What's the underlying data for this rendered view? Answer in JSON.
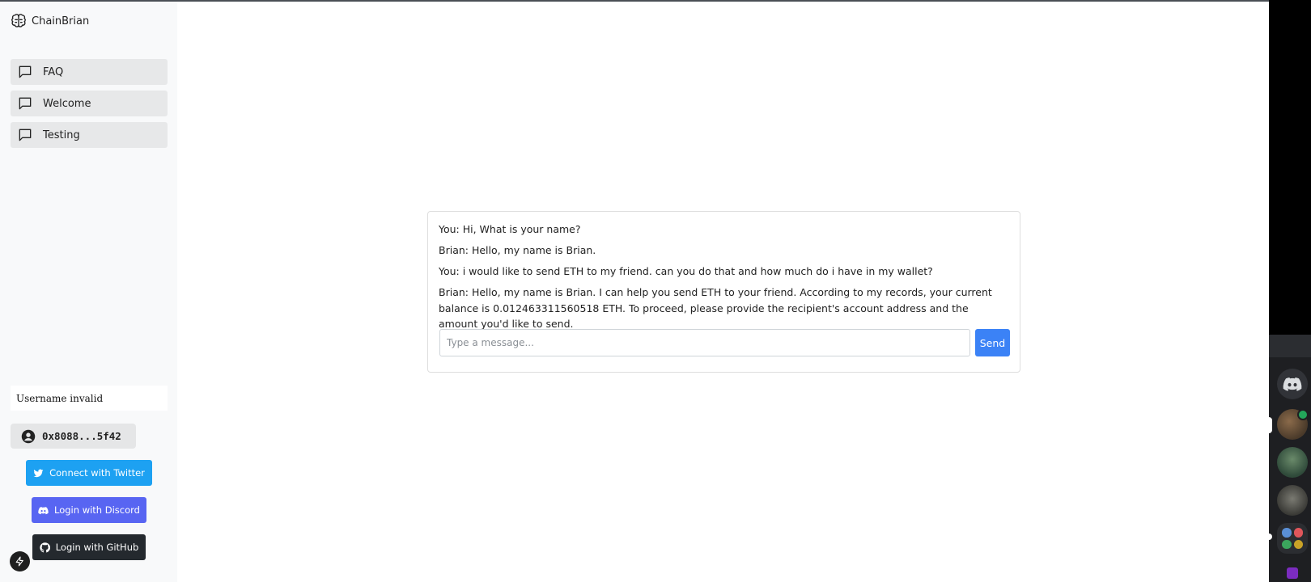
{
  "app": {
    "name": "ChainBrian",
    "logo_icon": "brain-icon"
  },
  "sidebar": {
    "items": [
      {
        "label": "FAQ",
        "icon": "chat-bubble-icon"
      },
      {
        "label": "Welcome",
        "icon": "chat-bubble-icon"
      },
      {
        "label": "Testing",
        "icon": "chat-bubble-icon"
      }
    ],
    "username_status": "Username invalid",
    "wallet": {
      "address": "0x8088...5f42",
      "icon": "user-circle-icon"
    },
    "auth": {
      "twitter_label": "Connect with Twitter",
      "discord_label": "Login with Discord",
      "github_label": "Login with GitHub"
    }
  },
  "chat": {
    "messages": [
      {
        "text": "You: Hi, What is your name?"
      },
      {
        "text": "Brian: Hello, my name is Brian."
      },
      {
        "text": "You: i would like to send ETH to my friend. can you do that and how much do i have in my wallet?"
      },
      {
        "text": "Brian: Hello, my name is Brian. I can help you send ETH to your friend. According to my records, your current balance is 0.012463311560518 ETH. To proceed, please provide the recipient's account address and the amount you'd like to send."
      }
    ],
    "input_placeholder": "Type a message...",
    "send_label": "Send"
  },
  "colors": {
    "twitter": "#1da1f2",
    "discord": "#5865f2",
    "github": "#24292e",
    "send": "#3b82f6"
  }
}
